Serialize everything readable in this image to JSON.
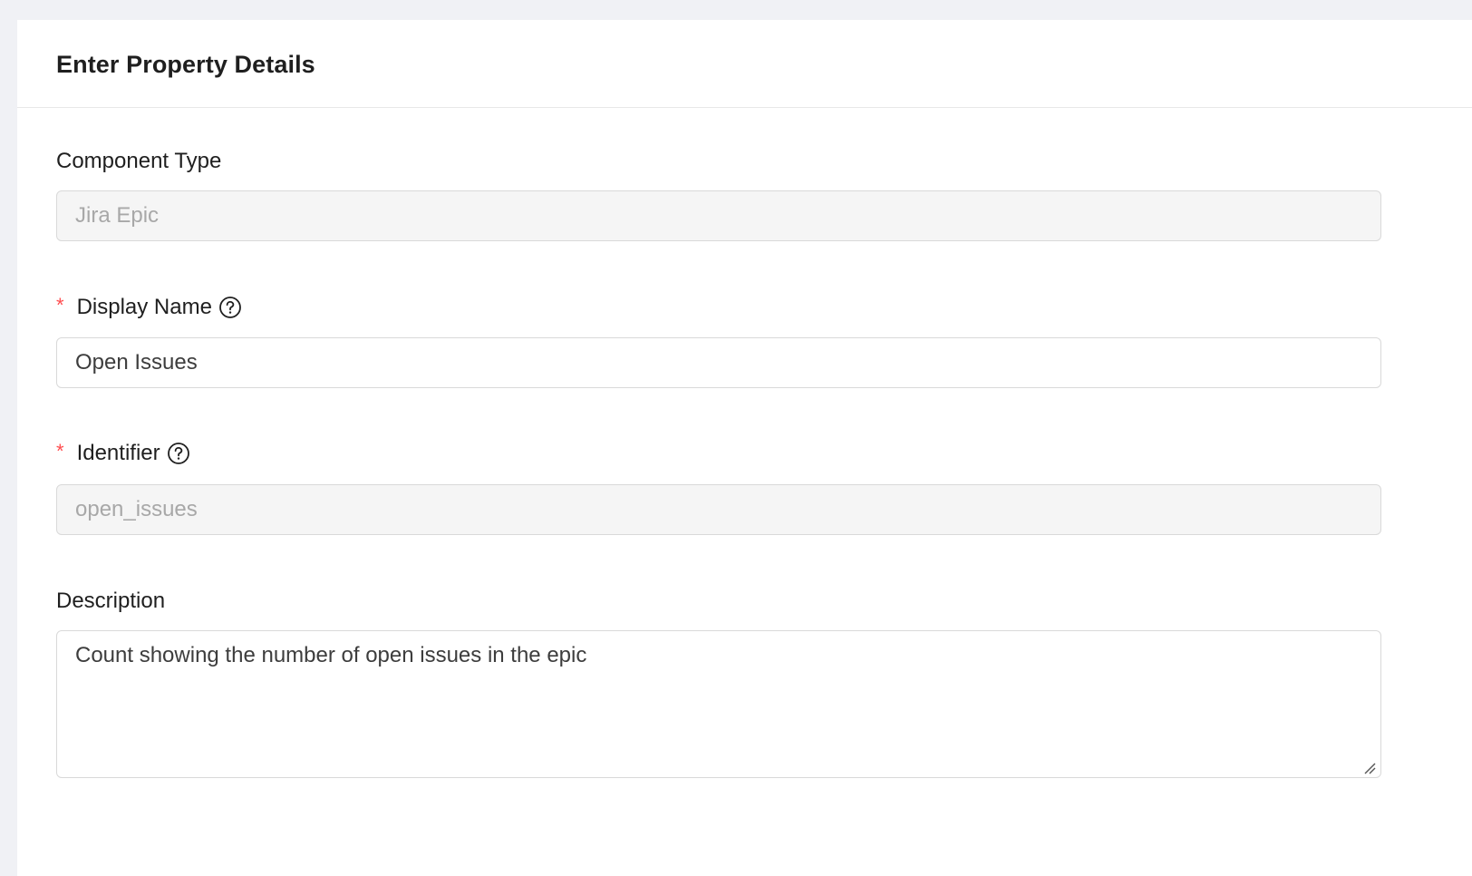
{
  "panel": {
    "title": "Enter Property Details"
  },
  "form": {
    "component_type": {
      "label": "Component Type",
      "value": "Jira Epic",
      "disabled": true
    },
    "display_name": {
      "label": "Display Name",
      "required_mark": "*",
      "value": "Open Issues",
      "help_icon": "question-circle-icon"
    },
    "identifier": {
      "label": "Identifier",
      "required_mark": "*",
      "value": "open_issues",
      "disabled": true,
      "help_icon": "question-circle-icon"
    },
    "description": {
      "label": "Description",
      "value": "Count showing the number of open issues in the epic"
    }
  },
  "colors": {
    "page_background": "#f0f1f5",
    "panel_background": "#ffffff",
    "required": "#ff4d4f",
    "border": "#d9d9d9",
    "disabled_background": "#f5f5f5",
    "disabled_text": "#a8a8a8"
  }
}
